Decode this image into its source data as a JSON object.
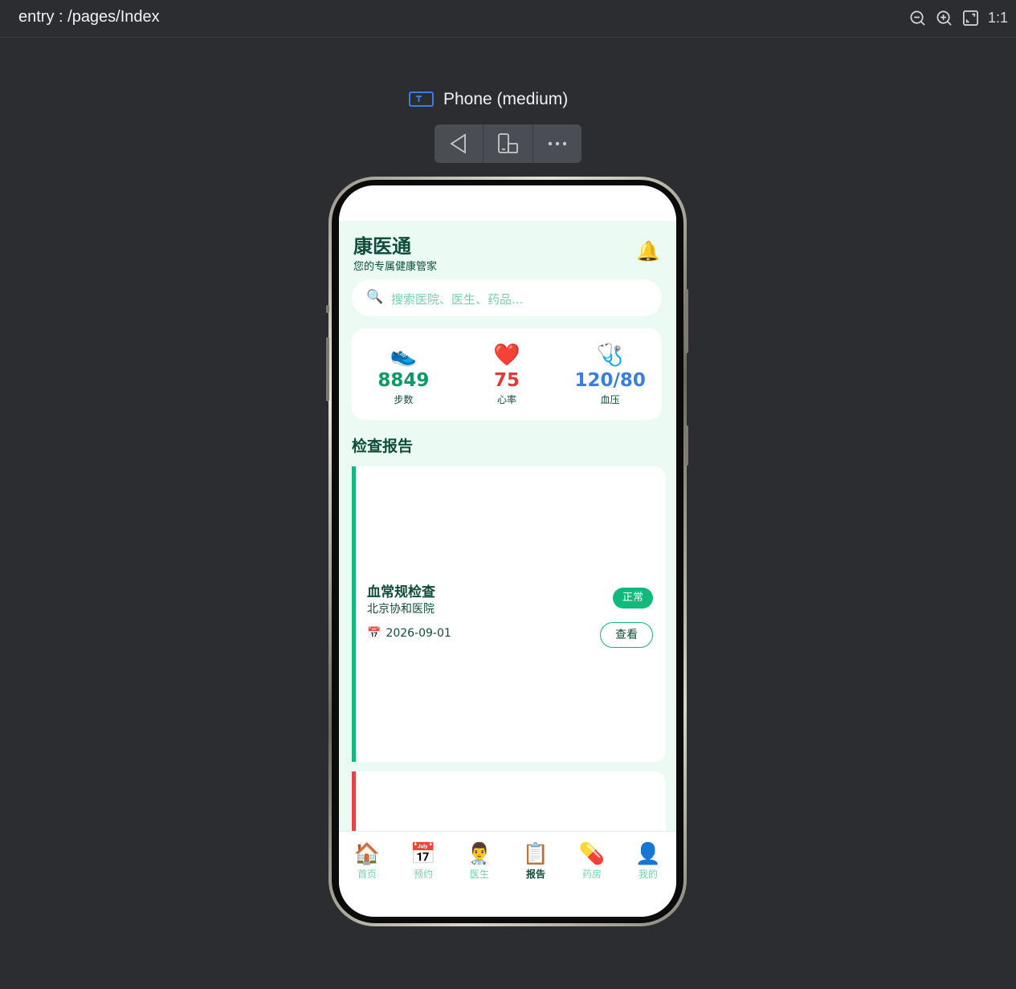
{
  "toolbar": {
    "route": "entry : /pages/Index",
    "tools": [
      {
        "name": "zoom-out-icon"
      },
      {
        "name": "zoom-in-icon"
      },
      {
        "name": "fit-screen-icon"
      },
      {
        "name": "actual-size",
        "label": "1:1"
      }
    ]
  },
  "device": {
    "label": "Phone (medium)"
  },
  "app": {
    "title": "康医通",
    "subtitle": "您的专属健康管家",
    "bell_icon": "🔔",
    "search": {
      "icon": "🔍",
      "placeholder": "搜索医院、医生、药品..."
    },
    "stats": [
      {
        "icon": "👟",
        "value": "8849",
        "label": "步数",
        "color": "#0f9a63"
      },
      {
        "icon": "❤️",
        "value": "75",
        "label": "心率",
        "color": "#e23b3b"
      },
      {
        "icon": "🩺",
        "value": "120/80",
        "label": "血压",
        "color": "#3b7ee2"
      }
    ],
    "section_title": "检查报告",
    "reports": [
      {
        "name": "血常规检查",
        "hospital": "北京协和医院",
        "date_icon": "📅",
        "date": "2026-09-01",
        "status": "正常",
        "status_color": "#12b97d",
        "action": "查看"
      }
    ],
    "tabs": [
      {
        "icon": "🏠",
        "label": "首页",
        "active": false
      },
      {
        "icon": "📅",
        "label": "预约",
        "active": false
      },
      {
        "icon": "👨‍⚕️",
        "label": "医生",
        "active": false
      },
      {
        "icon": "📋",
        "label": "报告",
        "active": true
      },
      {
        "icon": "💊",
        "label": "药房",
        "active": false
      },
      {
        "icon": "👤",
        "label": "我的",
        "active": false
      }
    ]
  }
}
